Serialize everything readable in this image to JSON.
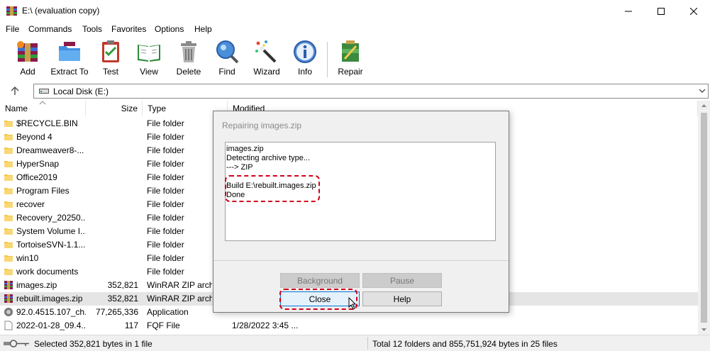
{
  "window": {
    "title": "E:\\ (evaluation copy)"
  },
  "menu": [
    "File",
    "Commands",
    "Tools",
    "Favorites",
    "Options",
    "Help"
  ],
  "toolbar": {
    "buttons": [
      {
        "label": "Add",
        "icon": "winrar-add-icon"
      },
      {
        "label": "Extract To",
        "icon": "extract-folder-icon"
      },
      {
        "label": "Test",
        "icon": "clipboard-check-icon"
      },
      {
        "label": "View",
        "icon": "book-icon"
      },
      {
        "label": "Delete",
        "icon": "trash-can-icon"
      },
      {
        "label": "Find",
        "icon": "magnifier-icon"
      },
      {
        "label": "Wizard",
        "icon": "magic-wand-icon"
      },
      {
        "label": "Info",
        "icon": "info-icon"
      },
      {
        "label": "Repair",
        "icon": "repair-kit-icon"
      }
    ]
  },
  "address": {
    "value": "Local Disk (E:)"
  },
  "columns": {
    "name": "Name",
    "size": "Size",
    "type": "Type",
    "modified": "Modified"
  },
  "files": [
    {
      "name": "$RECYCLE.BIN",
      "size": "",
      "type": "File folder",
      "modified": "",
      "icon": "folder"
    },
    {
      "name": "Beyond 4",
      "size": "",
      "type": "File folder",
      "modified": "",
      "icon": "folder"
    },
    {
      "name": "Dreamweaver8-...",
      "size": "",
      "type": "File folder",
      "modified": "",
      "icon": "folder"
    },
    {
      "name": "HyperSnap",
      "size": "",
      "type": "File folder",
      "modified": "",
      "icon": "folder"
    },
    {
      "name": "Office2019",
      "size": "",
      "type": "File folder",
      "modified": "",
      "icon": "folder"
    },
    {
      "name": "Program Files",
      "size": "",
      "type": "File folder",
      "modified": "",
      "icon": "folder"
    },
    {
      "name": "recover",
      "size": "",
      "type": "File folder",
      "modified": "",
      "icon": "folder"
    },
    {
      "name": "Recovery_20250...",
      "size": "",
      "type": "File folder",
      "modified": "",
      "icon": "folder"
    },
    {
      "name": "System Volume I...",
      "size": "",
      "type": "File folder",
      "modified": "",
      "icon": "folder"
    },
    {
      "name": "TortoiseSVN-1.1...",
      "size": "",
      "type": "File folder",
      "modified": "",
      "icon": "folder"
    },
    {
      "name": "win10",
      "size": "",
      "type": "File folder",
      "modified": "",
      "icon": "folder"
    },
    {
      "name": "work documents",
      "size": "",
      "type": "File folder",
      "modified": "",
      "icon": "folder"
    },
    {
      "name": "images.zip",
      "size": "352,821",
      "type": "WinRAR ZIP archi",
      "modified": "",
      "icon": "zip"
    },
    {
      "name": "rebuilt.images.zip",
      "size": "352,821",
      "type": "WinRAR ZIP archi",
      "modified": "",
      "icon": "zip",
      "selected": true
    },
    {
      "name": "92.0.4515.107_ch...",
      "size": "77,265,336",
      "type": "Application",
      "modified": "",
      "icon": "app"
    },
    {
      "name": "2022-01-28_09.4...",
      "size": "117",
      "type": "FQF File",
      "modified": "1/28/2022 3:45 ...",
      "icon": "file"
    }
  ],
  "status": {
    "left": "Selected 352,821 bytes in 1 file",
    "right": "Total 12 folders and 855,751,924 bytes in 25 files"
  },
  "dialog": {
    "title": "Repairing images.zip",
    "log": [
      "images.zip",
      "Detecting archive type...",
      "---> ZIP",
      "",
      "Build E:\\rebuilt.images.zip",
      "Done"
    ],
    "buttons": {
      "background": "Background",
      "pause": "Pause",
      "close": "Close",
      "help": "Help"
    }
  },
  "colors": {
    "highlight": "#d0021b",
    "folder": "#f4c542",
    "selection": "#e5e5e5"
  }
}
